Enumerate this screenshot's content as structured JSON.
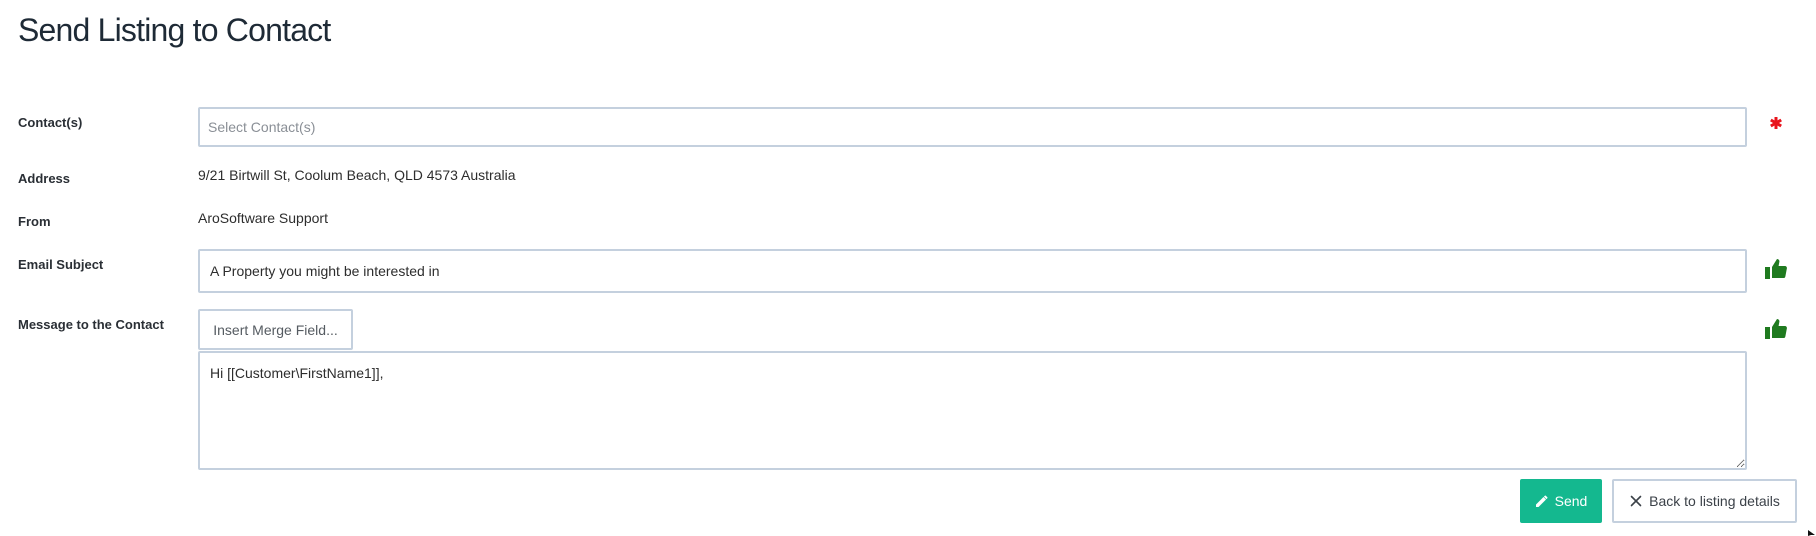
{
  "page": {
    "title": "Send Listing to Contact"
  },
  "form": {
    "contacts": {
      "label": "Contact(s)",
      "placeholder": "Select Contact(s)",
      "value": ""
    },
    "address": {
      "label": "Address",
      "value": "9/21 Birtwill St, Coolum Beach, QLD 4573 Australia"
    },
    "from": {
      "label": "From",
      "value": "AroSoftware Support"
    },
    "subject": {
      "label": "Email Subject",
      "value": "A Property you might be interested in"
    },
    "message": {
      "label": "Message to the Contact",
      "merge_button_label": "Insert Merge Field...",
      "value": "Hi [[Customer\\FirstName1]],"
    }
  },
  "actions": {
    "send_label": "Send",
    "back_label": "Back to listing details"
  },
  "icons": {
    "required": "asterisk-icon",
    "valid": "thumbs-up-icon",
    "send": "pencil-icon",
    "back": "close-icon"
  },
  "colors": {
    "required": "#e8141d",
    "valid": "#1f7a1f",
    "send_button": "#14b88f",
    "input_border": "#c4d0de"
  }
}
